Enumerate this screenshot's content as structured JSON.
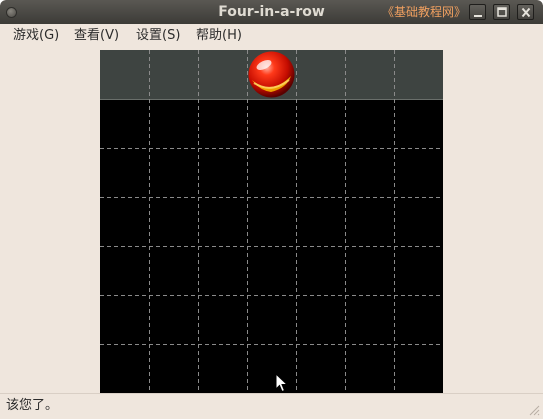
{
  "window": {
    "title": "Four-in-a-row",
    "watermark": "《基础教程网》"
  },
  "menu": {
    "items": [
      {
        "label": "游戏(G)"
      },
      {
        "label": "查看(V)"
      },
      {
        "label": "设置(S)"
      },
      {
        "label": "帮助(H)"
      }
    ]
  },
  "board": {
    "columns": 7,
    "rows": 6,
    "piece_color": "red",
    "grid_color": "#8a8a8a",
    "background": "#000000",
    "selector_bg": "#3e4441"
  },
  "status": {
    "text": "该您了。"
  },
  "colors": {
    "window_bg": "#efe6dd",
    "titlebar": "#3c3b37",
    "title_text": "#dfdbd2",
    "watermark": "#f0a060"
  }
}
